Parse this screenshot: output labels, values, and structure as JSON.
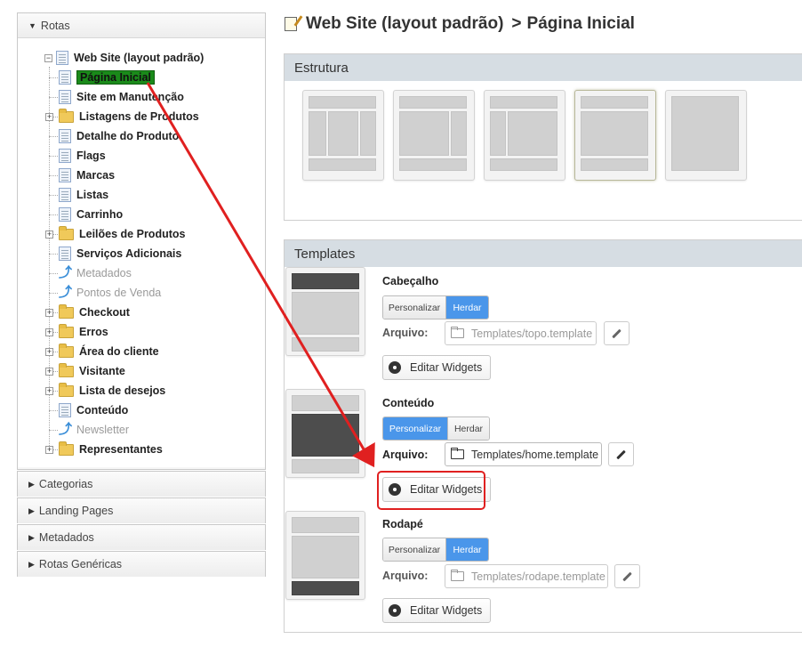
{
  "sidebar": {
    "sections": [
      {
        "label": "Rotas",
        "expanded": true
      },
      {
        "label": "Categorias",
        "expanded": false
      },
      {
        "label": "Landing Pages",
        "expanded": false
      },
      {
        "label": "Metadados",
        "expanded": false
      },
      {
        "label": "Rotas Genéricas",
        "expanded": false
      }
    ],
    "tree": {
      "root": "Web Site (layout padrão)",
      "items": [
        {
          "label": "Página Inicial",
          "icon": "page-icon",
          "selected": true
        },
        {
          "label": "Site em Manutenção",
          "icon": "page-icon"
        },
        {
          "label": "Listagens de Produtos",
          "icon": "folder-icon"
        },
        {
          "label": "Detalhe do Produto",
          "icon": "page-icon"
        },
        {
          "label": "Flags",
          "icon": "page-icon"
        },
        {
          "label": "Marcas",
          "icon": "page-icon"
        },
        {
          "label": "Listas",
          "icon": "page-icon"
        },
        {
          "label": "Carrinho",
          "icon": "page-icon"
        },
        {
          "label": "Leilões de Produtos",
          "icon": "folder-icon"
        },
        {
          "label": "Serviços Adicionais",
          "icon": "page-icon"
        },
        {
          "label": "Metadados",
          "icon": "arrow-up-icon",
          "disabled": true
        },
        {
          "label": "Pontos de Venda",
          "icon": "arrow-up-icon",
          "disabled": true
        },
        {
          "label": "Checkout",
          "icon": "folder-icon"
        },
        {
          "label": "Erros",
          "icon": "folder-icon"
        },
        {
          "label": "Área do cliente",
          "icon": "folder-icon"
        },
        {
          "label": "Visitante",
          "icon": "folder-icon"
        },
        {
          "label": "Lista de desejos",
          "icon": "folder-icon"
        },
        {
          "label": "Conteúdo",
          "icon": "page-icon"
        },
        {
          "label": "Newsletter",
          "icon": "arrow-up-icon",
          "disabled": true
        },
        {
          "label": "Representantes",
          "icon": "folder-icon"
        }
      ]
    }
  },
  "header": {
    "title": "Web Site (layout padrão)",
    "separator": ">",
    "current": "Página Inicial"
  },
  "estrutura": {
    "title": "Estrutura",
    "selected_index": 3
  },
  "templates": {
    "title": "Templates",
    "arquivo_label": "Arquivo:",
    "personalizar_label": "Personalizar",
    "herdar_label": "Herdar",
    "edit_widgets_label": "Editar Widgets",
    "items": [
      {
        "name": "Cabeçalho",
        "mode": "Herdar",
        "file": "Templates/topo.template"
      },
      {
        "name": "Conteúdo",
        "mode": "Personalizar",
        "file": "Templates/home.template"
      },
      {
        "name": "Rodapé",
        "mode": "Herdar",
        "file": "Templates/rodape.template"
      }
    ]
  },
  "colors": {
    "selected_node": "#1a8a1a",
    "toggle_on": "#4a96ea",
    "annotation": "#e02020",
    "panel_header": "#d6dde3"
  }
}
